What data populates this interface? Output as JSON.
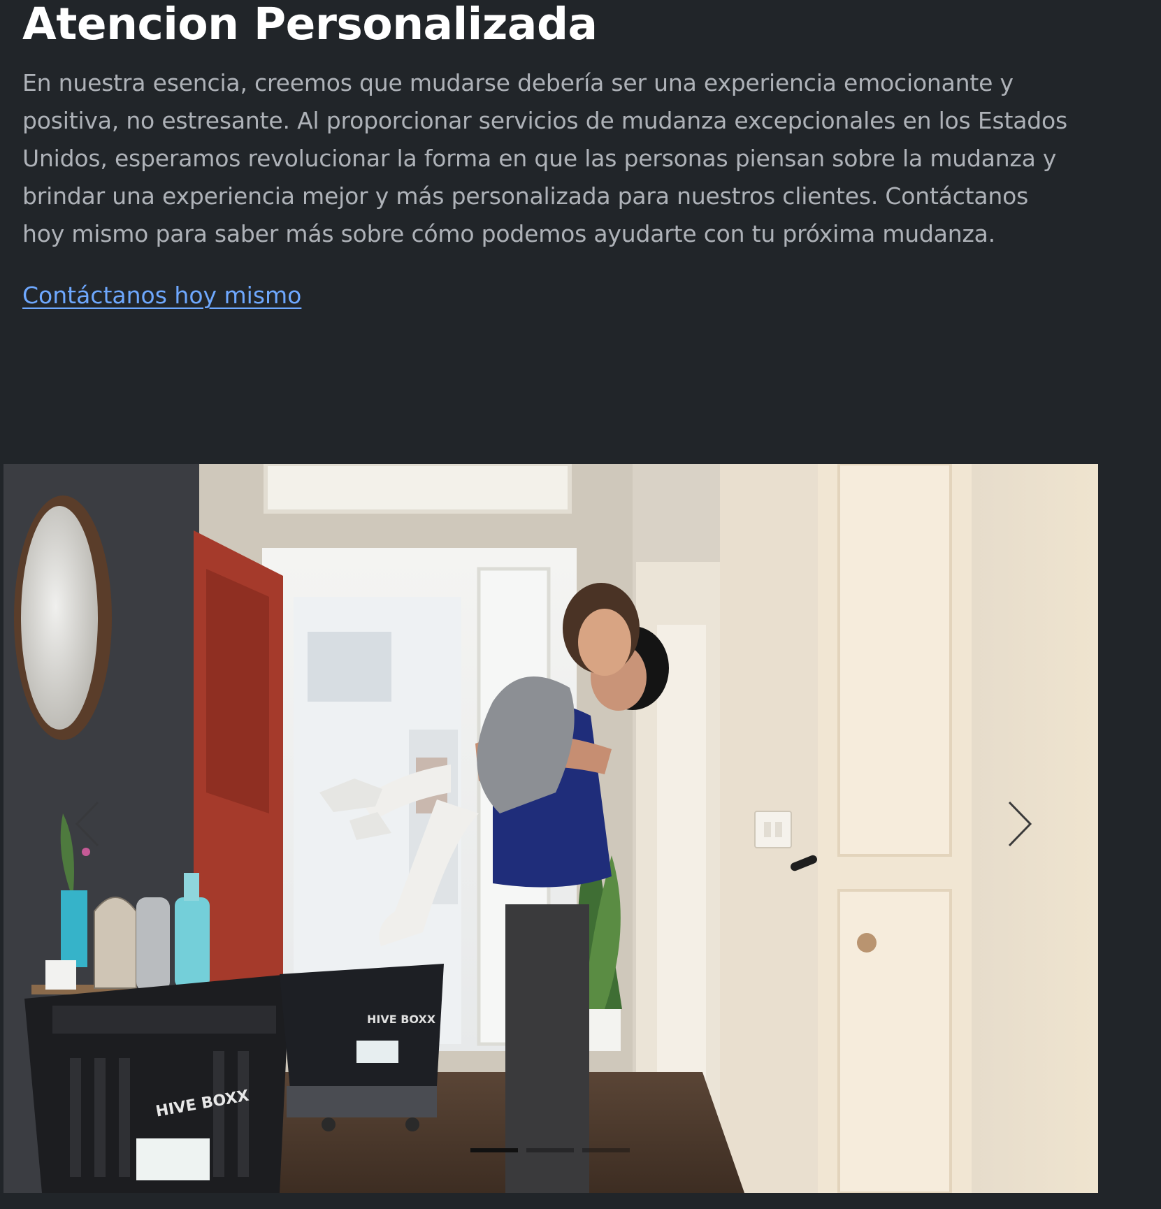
{
  "hero": {
    "title": "Atencion Personalizada",
    "paragraph": "En nuestra esencia, creemos que mudarse debería ser una experiencia emocionante y positiva, no estresante. Al proporcionar servicios de mudanza excepcionales en los Estados Unidos, esperamos revolucionar la forma en que las personas piensan sobre la mudanza y brindar una experiencia mejor y más personalizada para nuestros clientes. Contáctanos hoy mismo para saber más sobre cómo podemos ayudarte con tu próxima mudanza.",
    "cta_label": "Contáctanos hoy mismo"
  },
  "carousel": {
    "slide_count": 3,
    "active_index": 0,
    "prev_icon": "chevron-left-icon",
    "next_icon": "chevron-right-icon",
    "box_label_1": "HIVE BOXX",
    "box_label_2": "HIVE BOXX"
  },
  "colors": {
    "background": "#212529",
    "title": "#ffffff",
    "body_text": "#aeb2b8",
    "link": "#6ea8fe"
  }
}
